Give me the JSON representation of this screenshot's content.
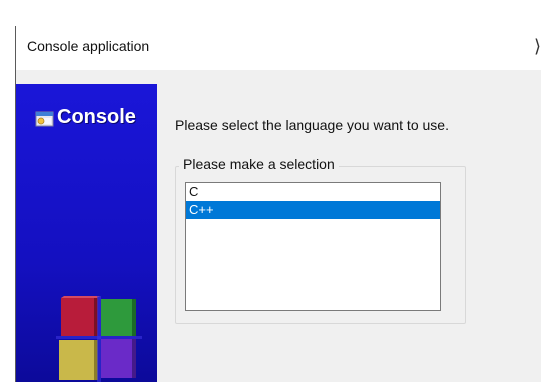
{
  "window": {
    "title": "Console application",
    "close_glyph": "⟩"
  },
  "banner": {
    "title": "Console",
    "icon": "console-app-icon",
    "graphic": "colored-cubes-graphic",
    "colors": {
      "top": "#1a16d8",
      "bottom": "#0c0a9a"
    }
  },
  "main": {
    "prompt": "Please select the language you want to use.",
    "group_label": "Please make a selection",
    "languages": [
      {
        "label": "C",
        "selected": false
      },
      {
        "label": "C++",
        "selected": true
      }
    ]
  },
  "colors": {
    "selection": "#0078d7",
    "dialog_bg": "#f0f0f0"
  }
}
